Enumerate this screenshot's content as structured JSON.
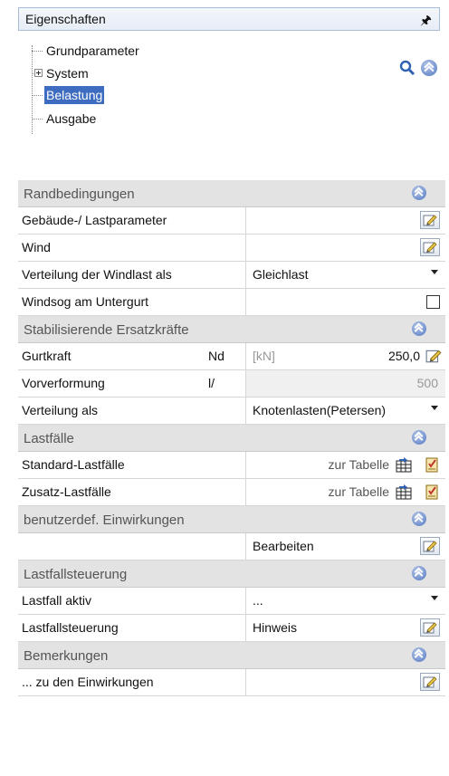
{
  "panel": {
    "title": "Eigenschaften",
    "pin_icon": "pin-icon"
  },
  "tree": {
    "items": [
      {
        "label": "Grundparameter"
      },
      {
        "label": "System"
      },
      {
        "label": "Belastung"
      },
      {
        "label": "Ausgabe"
      }
    ]
  },
  "sections": {
    "randbedingungen": {
      "title": "Randbedingungen",
      "rows": {
        "gebaeude": {
          "label": "Gebäude-/ Lastparameter"
        },
        "wind": {
          "label": "Wind"
        },
        "verteilung_wind": {
          "label": "Verteilung der Windlast als",
          "value": "Gleichlast"
        },
        "windsog": {
          "label": "Windsog am Untergurt",
          "checked": false
        }
      }
    },
    "stabilisierend": {
      "title": "Stabilisierende Ersatzkräfte",
      "rows": {
        "gurtkraft": {
          "label": "Gurtkraft",
          "symbol": "Nd",
          "unit": "[kN]",
          "value": "250,0"
        },
        "vorverformung": {
          "label": "Vorverformung",
          "symbol": "l/",
          "value": "500"
        },
        "verteilung": {
          "label": "Verteilung als",
          "value": "Knotenlasten(Petersen)"
        }
      }
    },
    "lastfaelle": {
      "title": "Lastfälle",
      "rows": {
        "standard": {
          "label": "Standard-Lastfälle",
          "link": "zur Tabelle"
        },
        "zusatz": {
          "label": "Zusatz-Lastfälle",
          "link": "zur Tabelle"
        }
      }
    },
    "einwirkungen": {
      "title": "benutzerdef. Einwirkungen",
      "rows": {
        "bearbeiten": {
          "value": "Bearbeiten"
        }
      }
    },
    "lastfallsteuerung": {
      "title": "Lastfallsteuerung",
      "rows": {
        "aktiv": {
          "label": "Lastfall aktiv",
          "value": "..."
        },
        "steuerung": {
          "label": "Lastfallsteuerung",
          "value": "Hinweis"
        }
      }
    },
    "bemerkungen": {
      "title": "Bemerkungen",
      "rows": {
        "einwirkungen": {
          "label": "... zu den Einwirkungen"
        }
      }
    }
  },
  "colors": {
    "selection": "#3e6cc0",
    "section_bg": "#e3e3e3",
    "accent": "#6f8fcc"
  }
}
